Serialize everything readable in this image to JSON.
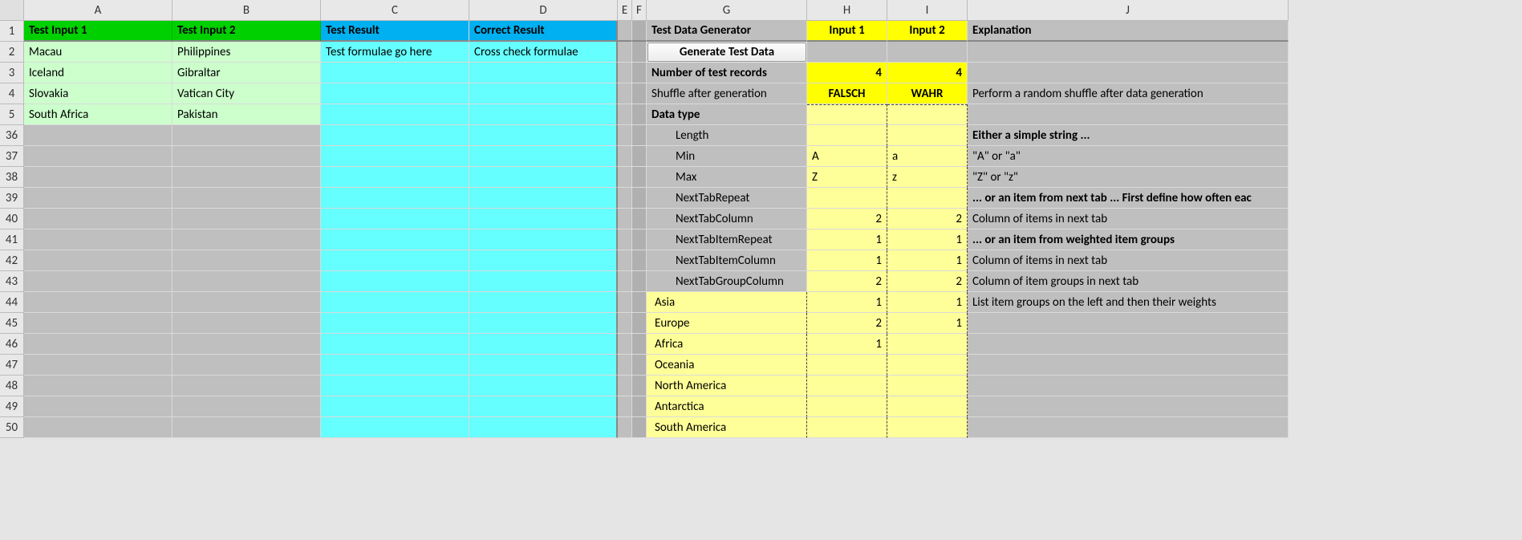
{
  "columns": [
    "A",
    "B",
    "C",
    "D",
    "E",
    "F",
    "G",
    "H",
    "I",
    "J"
  ],
  "row_headers_top": [
    "1",
    "2",
    "3",
    "4",
    "5"
  ],
  "row_headers_bottom": [
    "36",
    "37",
    "38",
    "39",
    "40",
    "41",
    "42",
    "43",
    "44",
    "45",
    "46",
    "47",
    "48",
    "49",
    "50"
  ],
  "header_row": {
    "A": "Test Input 1",
    "B": "Test Input 2",
    "C": "Test Result",
    "D": "Correct Result",
    "G": "Test Data Generator",
    "H": "Input 1",
    "I": "Input 2",
    "J": "Explanation"
  },
  "row2": {
    "A": "Macau",
    "B": "Philippines",
    "C": "Test formulae go here",
    "D": "Cross check formulae",
    "G_button": "Generate Test Data"
  },
  "row3": {
    "A": "Iceland",
    "B": "Gibraltar",
    "G": "Number of test records",
    "H": "4",
    "I": "4"
  },
  "row4": {
    "A": "Slovakia",
    "B": "Vatican City",
    "G": "Shuffle after generation",
    "H": "FALSCH",
    "I": "WAHR",
    "J": "Perform a random shuffle after data generation"
  },
  "row5": {
    "A": "South Africa",
    "B": "Pakistan",
    "G": "Data type"
  },
  "rows_bottom": [
    {
      "G": "Length",
      "H": "",
      "I": "",
      "J": "Either a simple string ...",
      "J_bold": true
    },
    {
      "G": "Min",
      "H": "A",
      "I": "a",
      "J": "\"A\" or \"a\""
    },
    {
      "G": "Max",
      "H": "Z",
      "I": "z",
      "J": "\"Z\" or \"z\""
    },
    {
      "G": "NextTabRepeat",
      "H": "",
      "I": "",
      "J": "... or an item from next tab ... First define how often eac",
      "J_bold": true
    },
    {
      "G": "NextTabColumn",
      "H": "2",
      "I": "2",
      "J": "Column of items in next tab"
    },
    {
      "G": "NextTabItemRepeat",
      "H": "1",
      "I": "1",
      "J": "... or an item from weighted item groups",
      "J_bold": true
    },
    {
      "G": "NextTabItemColumn",
      "H": "1",
      "I": "1",
      "J": "Column of items in next tab"
    },
    {
      "G": "NextTabGroupColumn",
      "H": "2",
      "I": "2",
      "J": "Column of item groups in next tab"
    },
    {
      "G": "Asia",
      "H": "1",
      "I": "1",
      "J": "List item groups on the left and then their weights",
      "G_yellow": true
    },
    {
      "G": "Europe",
      "H": "2",
      "I": "1",
      "J": "",
      "G_yellow": true
    },
    {
      "G": "Africa",
      "H": "1",
      "I": "",
      "J": "",
      "G_yellow": true
    },
    {
      "G": "Oceania",
      "H": "",
      "I": "",
      "J": "",
      "G_yellow": true
    },
    {
      "G": "North America",
      "H": "",
      "I": "",
      "J": "",
      "G_yellow": true
    },
    {
      "G": "Antarctica",
      "H": "",
      "I": "",
      "J": "",
      "G_yellow": true
    },
    {
      "G": "South America",
      "H": "",
      "I": "",
      "J": "",
      "G_yellow": true
    }
  ]
}
